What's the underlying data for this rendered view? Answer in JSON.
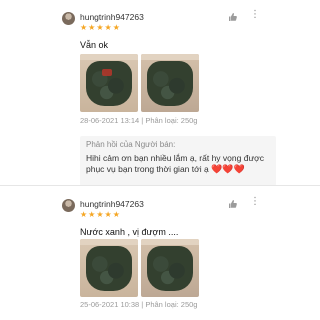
{
  "reviews": [
    {
      "username": "hungtrinh947263",
      "rating": 5,
      "comment": "Vẫn ok",
      "meta": "28-06-2021 13:14 | Phân loại: 250g",
      "seller_reply": {
        "title": "Phản hồi của Người bán:",
        "text": "Hihi cảm ơn bạn nhiều lắm ạ, rất hy vọng được phục vụ bạn trong thời gian tới ạ",
        "hearts": "❤️❤️❤️"
      }
    },
    {
      "username": "hungtrinh947263",
      "rating": 5,
      "comment": "Nước xanh , vị đượm ....",
      "meta": "25-06-2021 10:38 | Phân loại: 250g"
    }
  ],
  "icons": {
    "like": "thumbs-up-icon",
    "more": "more-dots-icon",
    "star": "star-icon",
    "star_color": "#f5a623"
  }
}
